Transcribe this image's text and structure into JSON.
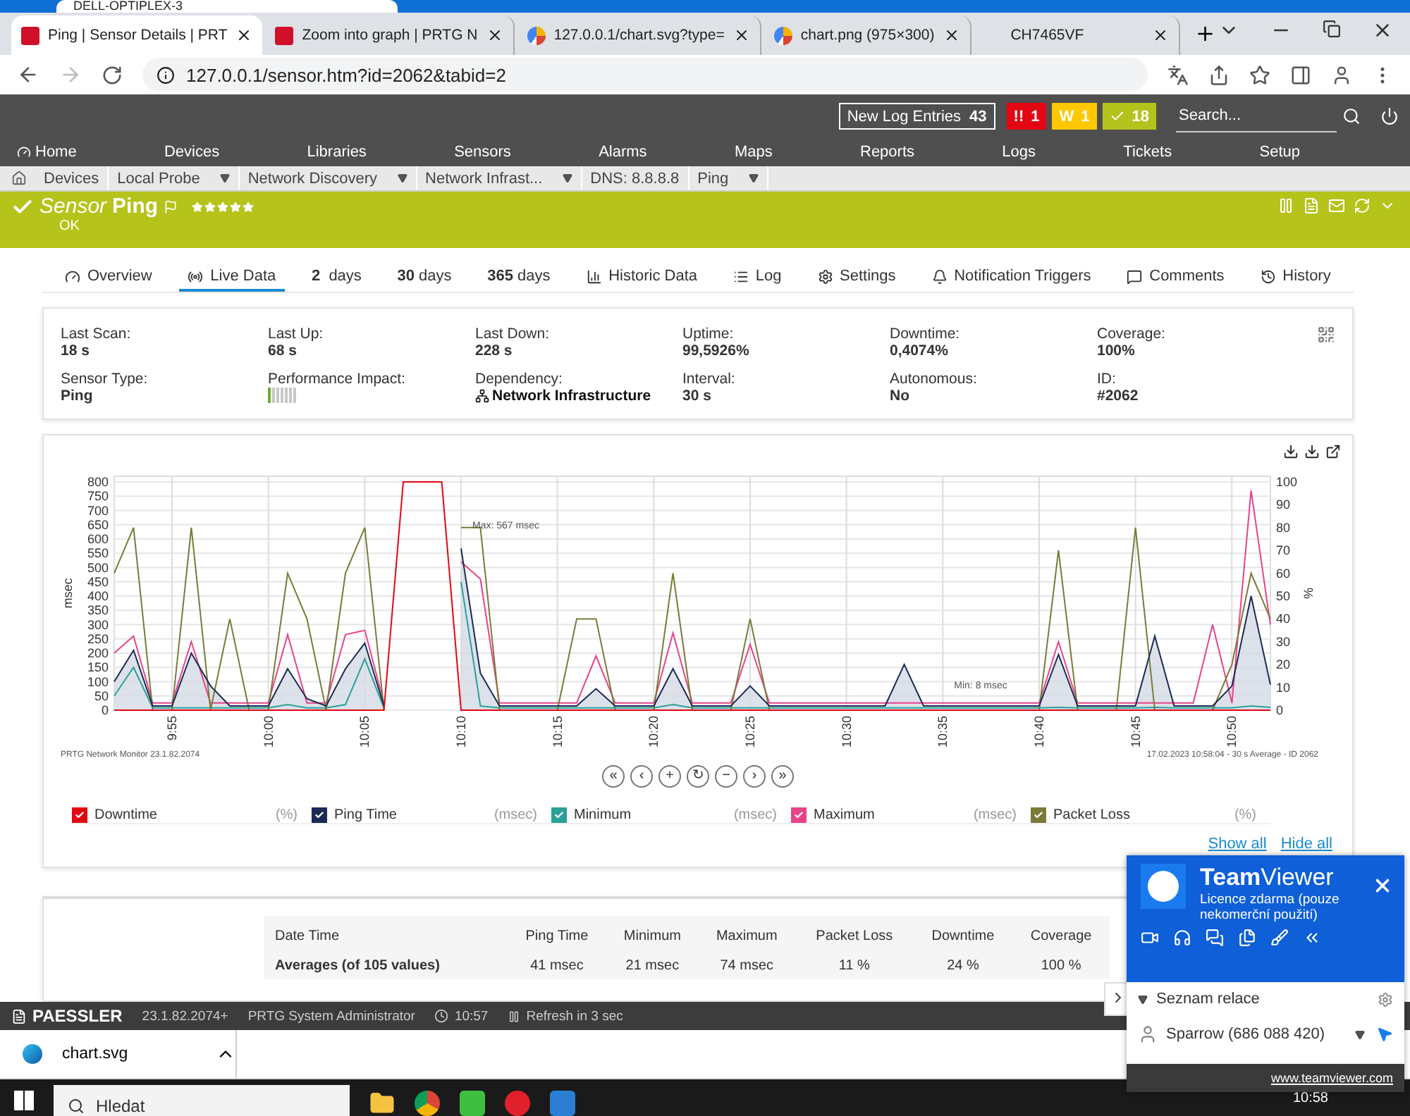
{
  "remote_tab": "DELL-OPTIPLEX-3",
  "browser_tabs": [
    {
      "title": "Ping | Sensor Details | PRT",
      "kind": "prtg",
      "selected": true
    },
    {
      "title": "Zoom into graph | PRTG N",
      "kind": "prtg",
      "selected": false
    },
    {
      "title": "127.0.0.1/chart.svg?type=",
      "kind": "chart",
      "selected": false
    },
    {
      "title": "chart.png (975×300)",
      "kind": "chart",
      "selected": false
    },
    {
      "title": "CH7465VF",
      "kind": "blank",
      "selected": false
    }
  ],
  "address": "127.0.0.1/sensor.htm?id=2062&tabid=2",
  "prtg_header": {
    "log_label": "New Log Entries",
    "log_count": "43",
    "search_placeholder": "Search...",
    "alarms": [
      {
        "kind": "error",
        "icon": "!!",
        "count": "1",
        "color": "#e30613"
      },
      {
        "kind": "warning",
        "icon": "W",
        "count": "1",
        "color": "#ffc800"
      },
      {
        "kind": "ok",
        "count": "18",
        "color": "#b4c31b"
      }
    ]
  },
  "nav": [
    "Home",
    "Devices",
    "Libraries",
    "Sensors",
    "Alarms",
    "Maps",
    "Reports",
    "Logs",
    "Tickets",
    "Setup"
  ],
  "breadcrumbs": [
    {
      "label": "Devices",
      "dropdown": false
    },
    {
      "label": "Local Probe",
      "dropdown": true
    },
    {
      "label": "Network Discovery",
      "dropdown": true
    },
    {
      "label": "Network Infrast...",
      "dropdown": true
    },
    {
      "label": "DNS: 8.8.8.8",
      "dropdown": false
    },
    {
      "label": "Ping",
      "dropdown": true
    }
  ],
  "sensor": {
    "type_label": "Sensor",
    "name": "Ping",
    "status": "OK",
    "stars": 5
  },
  "page_tabs": [
    {
      "label": "Overview",
      "selected": false
    },
    {
      "label": "Live Data",
      "selected": true
    },
    {
      "label": "**2**  days",
      "selected": false
    },
    {
      "label": "**30** days",
      "selected": false
    },
    {
      "label": "**365** days",
      "selected": false
    },
    {
      "label": "Historic Data",
      "selected": false
    },
    {
      "label": "Log",
      "selected": false
    },
    {
      "label": "Settings",
      "selected": false
    },
    {
      "label": "Notification Triggers",
      "selected": false
    },
    {
      "label": "Comments",
      "selected": false
    },
    {
      "label": "History",
      "selected": false
    }
  ],
  "info": [
    {
      "label": "Last Scan:",
      "kind": "text",
      "value": "18 s"
    },
    {
      "label": "Last Up:",
      "kind": "text",
      "value": "68 s"
    },
    {
      "label": "Last Down:",
      "kind": "text",
      "value": "228 s"
    },
    {
      "label": "Uptime:",
      "kind": "text",
      "value": "99,5926%"
    },
    {
      "label": "Downtime:",
      "kind": "text",
      "value": "0,4074%"
    },
    {
      "label": "Coverage:",
      "kind": "text",
      "value": "100%"
    },
    {
      "label": "Sensor Type:",
      "kind": "text",
      "value": "Ping"
    },
    {
      "label": "Performance Impact:",
      "kind": "meter",
      "level": 0.15
    },
    {
      "label": "Dependency:",
      "kind": "link",
      "value": "Network Infrastructure"
    },
    {
      "label": "Interval:",
      "kind": "text",
      "value": "30 s"
    },
    {
      "label": "Autonomous:",
      "kind": "text",
      "value": "No"
    },
    {
      "label": "ID:",
      "kind": "text",
      "value": "#2062"
    }
  ],
  "chart": {
    "footer_left": "PRTG Network Monitor 23.1.82.2074",
    "footer_right": "17.02.2023 10:58:04 - 30 s Average - ID 2062",
    "chart_data": {
      "type": "line",
      "grid": true,
      "ylabel": "msec",
      "y2label": "%",
      "ylim": [
        0,
        820
      ],
      "y2lim": [
        0,
        102.5
      ],
      "categories": [
        null,
        null,
        null,
        "9:55",
        null,
        null,
        null,
        null,
        "10:00",
        null,
        null,
        null,
        null,
        "10:05",
        null,
        null,
        null,
        null,
        "10:10",
        null,
        null,
        null,
        null,
        "10:15",
        null,
        null,
        null,
        null,
        "10:20",
        null,
        null,
        null,
        null,
        "10:25",
        null,
        null,
        null,
        null,
        "10:30",
        null,
        null,
        null,
        null,
        "10:35",
        null,
        null,
        null,
        null,
        "10:40",
        null,
        null,
        null,
        null,
        "10:45",
        null,
        null,
        null,
        null,
        "10:50",
        null,
        null
      ],
      "yticks": [
        0,
        50,
        100,
        150,
        200,
        250,
        300,
        350,
        400,
        450,
        500,
        550,
        600,
        650,
        700,
        750,
        800
      ],
      "y2ticks": [
        0,
        10,
        20,
        30,
        40,
        50,
        60,
        70,
        80,
        90,
        100
      ],
      "annotations": [
        {
          "x": "10:10",
          "y": 567,
          "text": "Max: 567 msec"
        },
        {
          "x": "10:35",
          "y": 8,
          "text": "Min: 8 msec"
        }
      ],
      "series": [
        {
          "name": "Downtime",
          "axis": "y2",
          "color": "#e30613",
          "values": [
            0,
            0,
            0,
            0,
            0,
            0,
            0,
            0,
            0,
            0,
            0,
            0,
            0,
            0,
            0,
            100,
            100,
            100,
            0,
            0,
            0,
            0,
            0,
            0,
            0,
            0,
            0,
            0,
            0,
            0,
            0,
            0,
            0,
            0,
            0,
            0,
            0,
            0,
            0,
            0,
            0,
            0,
            0,
            0,
            0,
            0,
            0,
            0,
            0,
            0,
            0,
            0,
            0,
            0,
            0,
            0,
            0,
            0,
            0,
            0,
            0
          ]
        },
        {
          "name": "Ping Time",
          "type": "area",
          "color": "#1b2a55",
          "values": [
            100,
            210,
            15,
            15,
            200,
            85,
            15,
            15,
            15,
            145,
            40,
            15,
            145,
            235,
            15,
            null,
            null,
            null,
            567,
            130,
            15,
            15,
            15,
            15,
            15,
            75,
            15,
            15,
            15,
            145,
            15,
            15,
            15,
            85,
            15,
            15,
            15,
            15,
            15,
            15,
            15,
            160,
            15,
            15,
            15,
            15,
            15,
            15,
            15,
            195,
            15,
            15,
            15,
            15,
            260,
            15,
            15,
            15,
            85,
            400,
            90
          ]
        },
        {
          "name": "Minimum",
          "color": "#2aa198",
          "values": [
            50,
            150,
            8,
            8,
            8,
            8,
            8,
            8,
            8,
            20,
            8,
            8,
            20,
            180,
            8,
            null,
            null,
            null,
            450,
            15,
            8,
            8,
            8,
            8,
            8,
            8,
            8,
            8,
            8,
            20,
            8,
            8,
            8,
            8,
            8,
            8,
            8,
            8,
            8,
            8,
            8,
            8,
            8,
            8,
            8,
            8,
            8,
            8,
            8,
            10,
            8,
            8,
            8,
            8,
            10,
            8,
            8,
            8,
            8,
            15,
            10
          ]
        },
        {
          "name": "Maximum",
          "color": "#e8438a",
          "values": [
            200,
            260,
            25,
            25,
            240,
            25,
            25,
            25,
            25,
            265,
            25,
            25,
            265,
            280,
            25,
            null,
            null,
            null,
            520,
            460,
            25,
            25,
            25,
            25,
            25,
            190,
            25,
            25,
            25,
            270,
            25,
            25,
            25,
            230,
            25,
            25,
            25,
            25,
            25,
            25,
            25,
            25,
            25,
            25,
            25,
            25,
            25,
            25,
            25,
            240,
            25,
            25,
            25,
            25,
            25,
            25,
            25,
            300,
            25,
            770,
            300
          ]
        },
        {
          "name": "Packet Loss",
          "axis": "y2",
          "color": "#7a7a3a",
          "values": [
            60,
            80,
            0,
            0,
            80,
            0,
            40,
            0,
            0,
            60,
            40,
            0,
            60,
            80,
            0,
            null,
            null,
            null,
            80,
            80,
            0,
            null,
            null,
            0,
            40,
            40,
            0,
            null,
            0,
            60,
            0,
            null,
            0,
            40,
            0,
            null,
            null,
            null,
            null,
            null,
            null,
            null,
            null,
            null,
            null,
            null,
            null,
            null,
            0,
            70,
            0,
            null,
            0,
            80,
            0,
            null,
            null,
            0,
            20,
            60,
            40
          ]
        }
      ]
    },
    "nav_buttons": [
      "«",
      "‹",
      "+",
      "↻",
      "−",
      "›",
      "»"
    ]
  },
  "legend": [
    {
      "unit": "(%)",
      "checked": true
    },
    {
      "unit": "(msec)",
      "checked": true
    },
    {
      "unit": "(msec)",
      "checked": true
    },
    {
      "unit": "(msec)",
      "checked": true
    },
    {
      "unit": "(%)",
      "checked": true
    }
  ],
  "legend_links": [
    "Show all",
    "Hide all"
  ],
  "table": {
    "columns": [
      "Date Time",
      "Ping Time",
      "Minimum",
      "Maximum",
      "Packet Loss",
      "Downtime",
      "Coverage"
    ],
    "rows": [
      [
        "Averages (of 105 values)",
        "41 msec",
        "21 msec",
        "74 msec",
        "11 %",
        "24 %",
        "100 %"
      ]
    ]
  },
  "footer": {
    "brand": "PAESSLER",
    "version": "23.1.82.2074+",
    "user": "PRTG System Administrator",
    "time": "10:57",
    "refresh": "Refresh in 3 sec"
  },
  "downloads": [
    {
      "name": "chart.svg"
    }
  ],
  "taskbar": {
    "search": "Hledat",
    "time": "10:58"
  },
  "teamviewer": {
    "title": "**Team**Viewer",
    "license": "Licence zdarma (pouze nekomerční použití)",
    "section": "Seznam relace",
    "contact": "Sparrow (686 088 420)",
    "link": "www.teamviewer.com"
  }
}
